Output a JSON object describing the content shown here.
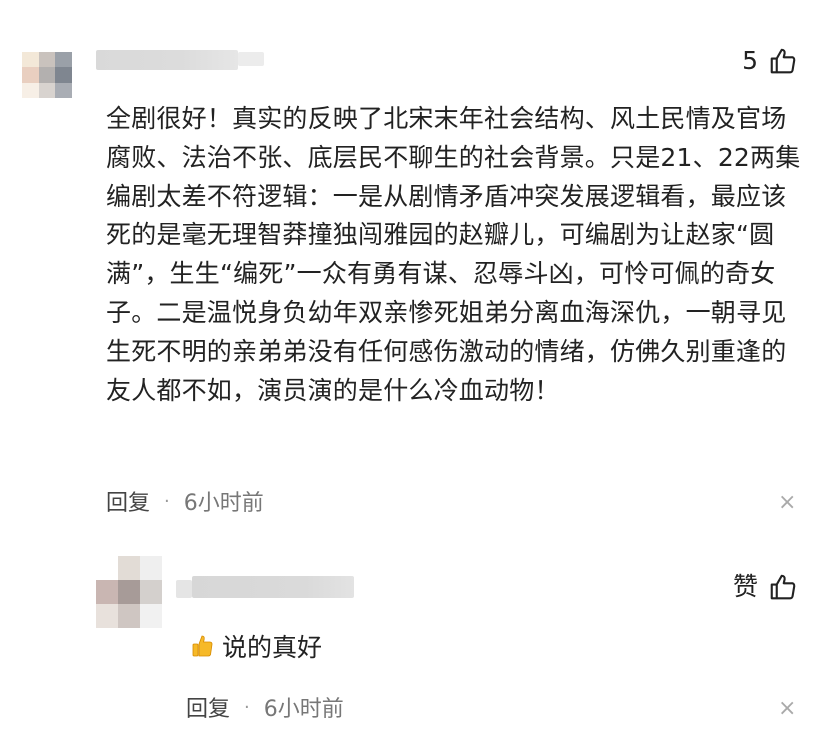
{
  "comment": {
    "likes": "5",
    "text": "全剧很好！真实的反映了北宋末年社会结构、风土民情及官场腐败、法治不张、底层民不聊生的社会背景。只是21、22两集编剧太差不符逻辑：一是从剧情矛盾冲突发展逻辑看，最应该死的是毫无理智莽撞独闯雅园的赵瓣儿，可编剧为让赵家“圆满”，生生“编死”一众有勇有谋、忍辱斗凶，可怜可佩的奇女子。二是温悦身负幼年双亲惨死姐弟分离血海深仇，一朝寻见生死不明的亲弟弟没有任何感伤激动的情绪，仿佛久别重逢的友人都不如，演员演的是什么冷血动物！",
    "reply_label": "回复",
    "separator": "·",
    "time": "6小时前",
    "close": "×"
  },
  "reply": {
    "like_label": "赞",
    "emoji": "thumbs-up-emoji",
    "text": "说的真好",
    "reply_label": "回复",
    "separator": "·",
    "time": "6小时前",
    "close": "×"
  },
  "colors": {
    "text": "#222222",
    "meta": "#777777",
    "close": "#aaaaaa"
  }
}
